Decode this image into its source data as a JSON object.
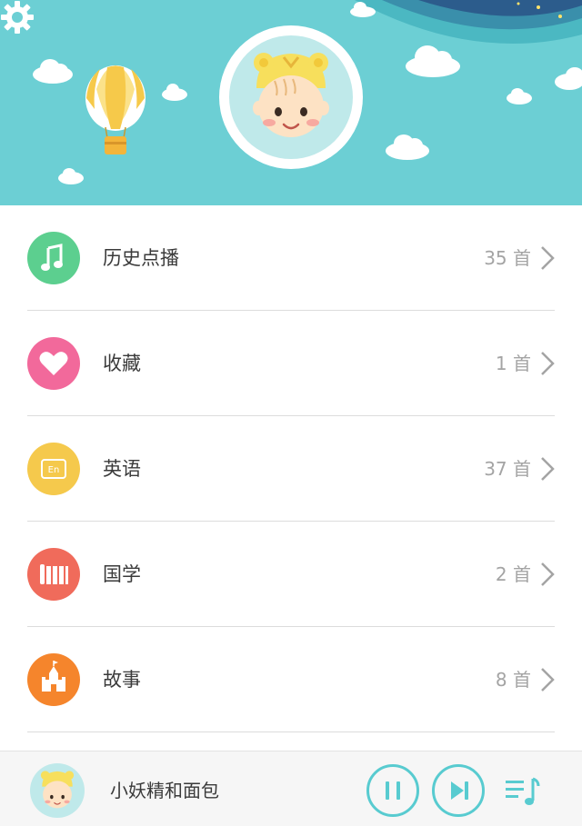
{
  "menu": [
    {
      "label": "历史点播",
      "count": "35 首",
      "icon": "music-note-icon",
      "color": "#5ccf8f"
    },
    {
      "label": "收藏",
      "count": "1 首",
      "icon": "heart-icon",
      "color": "#f2699b"
    },
    {
      "label": "英语",
      "count": "37 首",
      "icon": "english-book-icon",
      "color": "#f5c94c"
    },
    {
      "label": "国学",
      "count": "2 首",
      "icon": "bamboo-scroll-icon",
      "color": "#f06b5b"
    },
    {
      "label": "故事",
      "count": "8 首",
      "icon": "castle-icon",
      "color": "#f5852c"
    }
  ],
  "player": {
    "song_title": "小妖精和面包"
  },
  "colors": {
    "header_bg": "#6ccfd4",
    "accent": "#58cbd0"
  }
}
